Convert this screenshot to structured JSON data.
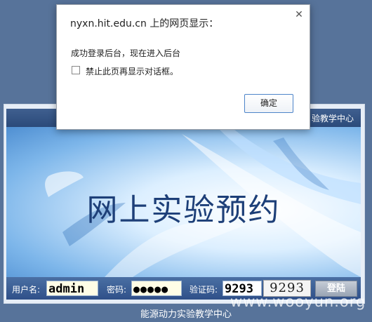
{
  "alert": {
    "title": "nyxn.hit.edu.cn 上的网页显示：",
    "message": "成功登录后台，现在进入后台",
    "suppress_label": "禁止此页再显示对话框。",
    "suppress_checked": false,
    "ok_label": "确定",
    "close_icon": "close-icon"
  },
  "header": {
    "text": "验教学中心"
  },
  "banner": {
    "title": "网上实验预约"
  },
  "login": {
    "username_label": "用户名:",
    "username_value": "admin",
    "password_label": "密码:",
    "password_value": "●●●●●",
    "captcha_label": "验证码:",
    "captcha_value": "9293",
    "captcha_image_text": "9293",
    "login_button": "登陆"
  },
  "footer": {
    "text": "能源动力实验教学中心"
  },
  "watermark": "www.wooyun.org",
  "colors": {
    "page_bg": "#57739a",
    "bar": "#2f5089",
    "input_bg": "#fffde6",
    "dialog_button_border": "#4d84c9"
  }
}
